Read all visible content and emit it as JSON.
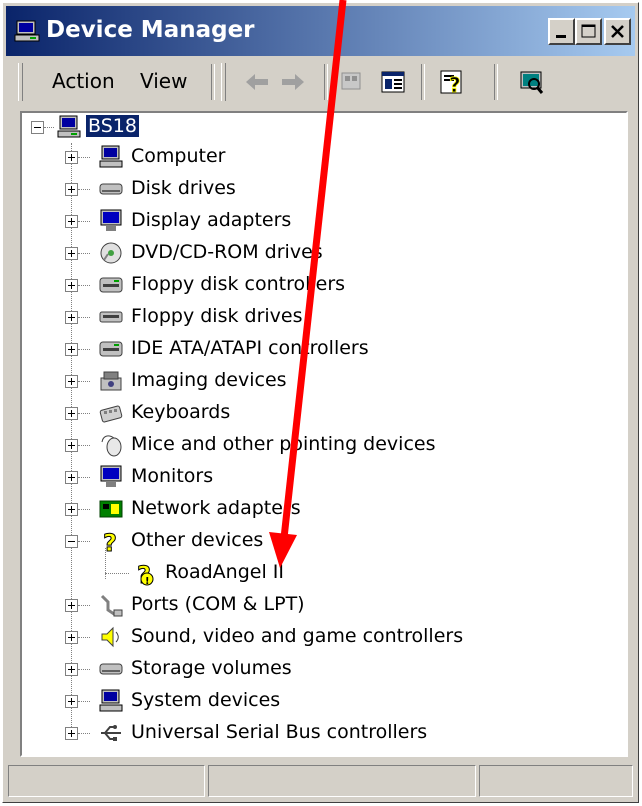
{
  "window": {
    "title": "Device Manager",
    "minimize_glyph": "minimize-icon",
    "maximize_glyph": "maximize-icon",
    "close_glyph": "close-icon"
  },
  "menu": {
    "action": "Action",
    "view": "View"
  },
  "tree": {
    "root": "BS18",
    "items": [
      {
        "label": "Computer",
        "icon": "computer-icon",
        "expanded": false
      },
      {
        "label": "Disk drives",
        "icon": "disk-drive-icon",
        "expanded": false
      },
      {
        "label": "Display adapters",
        "icon": "display-adapter-icon",
        "expanded": false
      },
      {
        "label": "DVD/CD-ROM drives",
        "icon": "dvd-icon",
        "expanded": false
      },
      {
        "label": "Floppy disk controllers",
        "icon": "floppy-controller-icon",
        "expanded": false
      },
      {
        "label": "Floppy disk drives",
        "icon": "floppy-drive-icon",
        "expanded": false
      },
      {
        "label": "IDE ATA/ATAPI controllers",
        "icon": "ide-controller-icon",
        "expanded": false
      },
      {
        "label": "Imaging devices",
        "icon": "imaging-icon",
        "expanded": false
      },
      {
        "label": "Keyboards",
        "icon": "keyboard-icon",
        "expanded": false
      },
      {
        "label": "Mice and other pointing devices",
        "icon": "mouse-icon",
        "expanded": false
      },
      {
        "label": "Monitors",
        "icon": "monitor-icon",
        "expanded": false
      },
      {
        "label": "Network adapters",
        "icon": "network-adapter-icon",
        "expanded": false
      },
      {
        "label": "Other devices",
        "icon": "unknown-device-icon",
        "expanded": true
      },
      {
        "label": "RoadAngel II",
        "icon": "warning-device-icon",
        "child": true
      },
      {
        "label": "Ports (COM & LPT)",
        "icon": "port-icon",
        "expanded": false
      },
      {
        "label": "Sound, video and game controllers",
        "icon": "sound-icon",
        "expanded": false
      },
      {
        "label": "Storage volumes",
        "icon": "storage-volume-icon",
        "expanded": false
      },
      {
        "label": "System devices",
        "icon": "system-device-icon",
        "expanded": false
      },
      {
        "label": "Universal Serial Bus controllers",
        "icon": "usb-icon",
        "expanded": false
      }
    ]
  },
  "colors": {
    "titlebar_start": "#0a246a",
    "titlebar_end": "#a6caf0",
    "annotation_arrow": "#ff0000",
    "selection": "#0a246a"
  }
}
